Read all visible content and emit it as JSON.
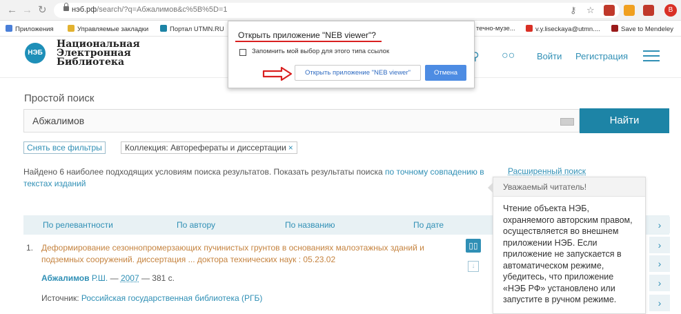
{
  "browser": {
    "url_host": "нэб.рф",
    "url_path": "/search/?q=Абжалимов&c%5B%5D=1",
    "profile_initial": "B",
    "bookmarks": [
      "Приложения",
      "Управляемые закладки",
      "Портал UTMN.RU",
      "течно-музе...",
      "v.y.liseckaya@utmn....",
      "Save to Mendeley"
    ]
  },
  "header": {
    "logo_mark": "НЭБ",
    "logo_line1": "Национальная",
    "logo_line2": "Электронная",
    "logo_line3": "Библиотека",
    "login": "Войти",
    "register": "Регистрация"
  },
  "search": {
    "label": "Простой поиск",
    "query": "Абжалимов",
    "button": "Найти"
  },
  "filters": {
    "reset": "Снять все фильтры",
    "tag": "Коллекция: Авторефераты и диссертации",
    "tag_close": "×"
  },
  "results_info": {
    "text": "Найдено 6 наиболее подходящих условиям поиска результатов. Показать результаты поиска ",
    "link": "по точному совпадению в текстах изданий",
    "advanced": "Расширенный поиск"
  },
  "sort": {
    "relevance": "По релевантности",
    "author": "По автору",
    "title": "По названию",
    "date": "По дате"
  },
  "result": {
    "number": "1.",
    "title": "Деформирование сезоннопромерзающих пучинистых грунтов в основаниях малоэтажных зданий и подземных сооружений. диссертация ... доктора технических наук : 05.23.02",
    "author_bold": "Абжалимов",
    "author_rest": " Р.Ш.",
    "sep1": " — ",
    "year": "2007",
    "sep2": " — 381 с.",
    "source_label": "Источник: ",
    "source": "Российская государственная библиотека (РГБ)"
  },
  "tooltip": {
    "header": "Уважаемый читатель!",
    "body": "Чтение объекта НЭБ, охраняемого авторским правом, осуществляется во внешнем приложении НЭБ. Если приложение не запускается в автоматическом режиме, убедитесь, что приложение «НЭБ РФ» установлено или запустите в ручном режиме."
  },
  "dialog": {
    "title": "Открыть приложение \"NEB viewer\"?",
    "remember": "Запомнить мой выбор для этого типа ссылок",
    "open_button": "Открыть приложение \"NEB viewer\"",
    "cancel_button": "Отмена"
  },
  "colors": {
    "accent": "#1d84a6",
    "link": "#2f8fb5",
    "result_title": "#c5833f",
    "annotation_red": "#d92020"
  }
}
